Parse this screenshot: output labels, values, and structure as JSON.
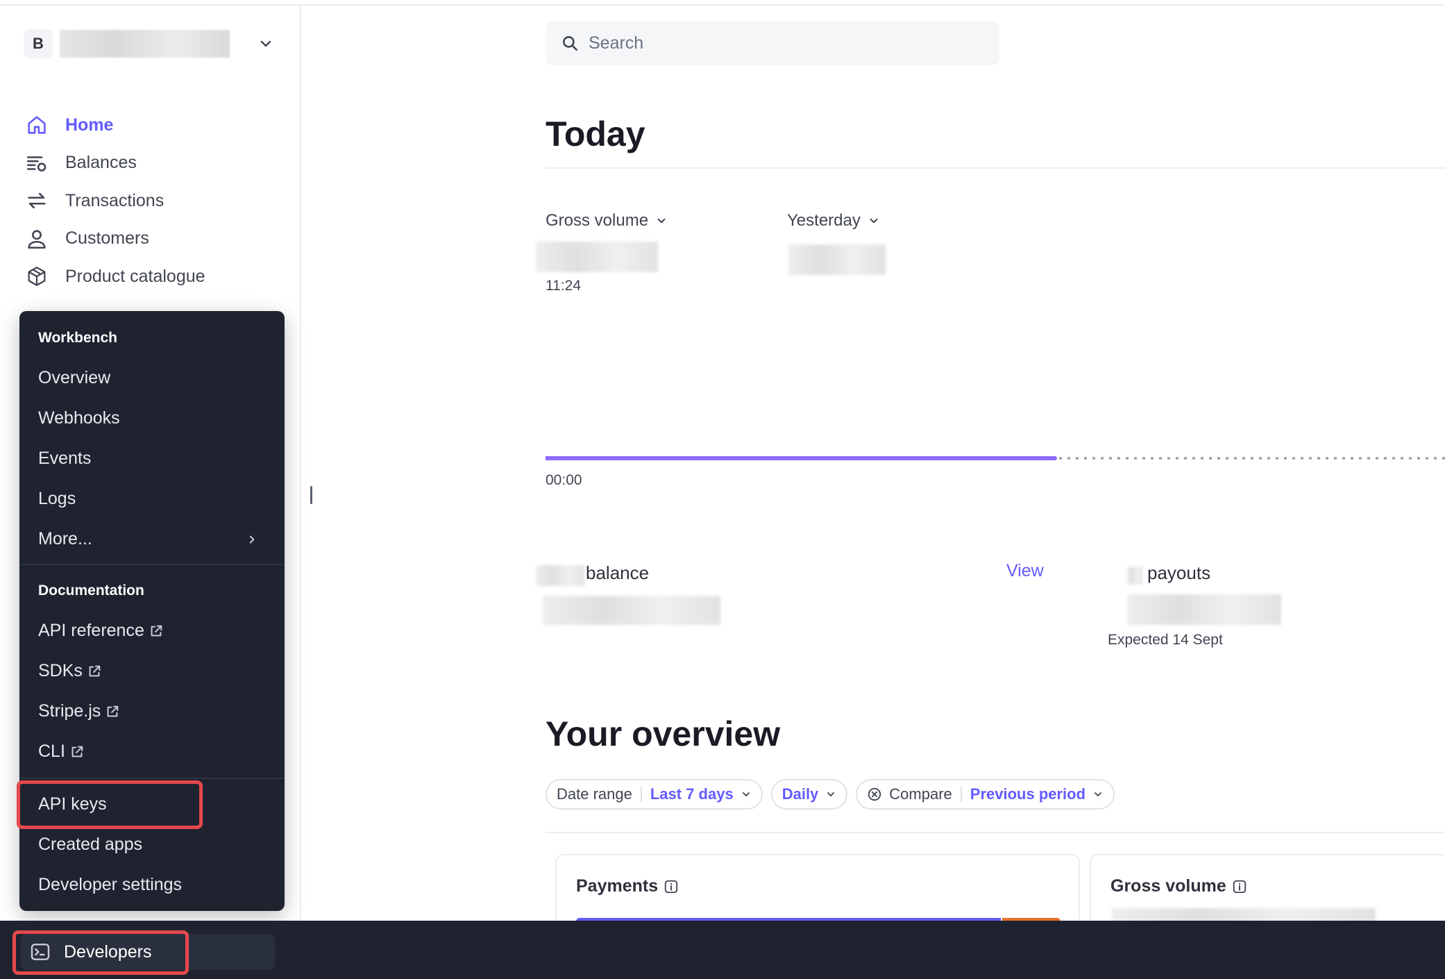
{
  "account": {
    "badge": "B"
  },
  "sidebar": {
    "items": [
      {
        "label": "Home",
        "icon": "home-icon",
        "active": true
      },
      {
        "label": "Balances",
        "icon": "balances-icon"
      },
      {
        "label": "Transactions",
        "icon": "transactions-icon"
      },
      {
        "label": "Customers",
        "icon": "customer-icon"
      },
      {
        "label": "Product catalogue",
        "icon": "box-icon"
      }
    ]
  },
  "developer_menu": {
    "workbench_heading": "Workbench",
    "workbench_items": [
      "Overview",
      "Webhooks",
      "Events",
      "Logs",
      "More..."
    ],
    "documentation_heading": "Documentation",
    "documentation_items": [
      "API reference",
      "SDKs",
      "Stripe.js",
      "CLI"
    ],
    "other_items": [
      "API keys",
      "Created apps",
      "Developer settings"
    ]
  },
  "bottom_bar": {
    "developers_label": "Developers"
  },
  "search": {
    "placeholder": "Search"
  },
  "today": {
    "title": "Today",
    "metric_selector": "Gross volume",
    "compare_selector": "Yesterday",
    "current_time": "11:24",
    "start_time": "00:00",
    "balance_label": "balance",
    "view_link": "View",
    "payouts_label": "payouts",
    "payouts_expected": "Expected 14 Sept"
  },
  "overview": {
    "title": "Your overview",
    "filters": {
      "date_range_label": "Date range",
      "date_range_value": "Last 7 days",
      "interval_value": "Daily",
      "compare_label": "Compare",
      "compare_value": "Previous period"
    },
    "cards": [
      "Payments",
      "Gross volume"
    ]
  },
  "colors": {
    "accent": "#635bff",
    "menu_bg": "#1f2330",
    "highlight": "#e5484d",
    "payments_bar_orange": "#e8702a"
  }
}
